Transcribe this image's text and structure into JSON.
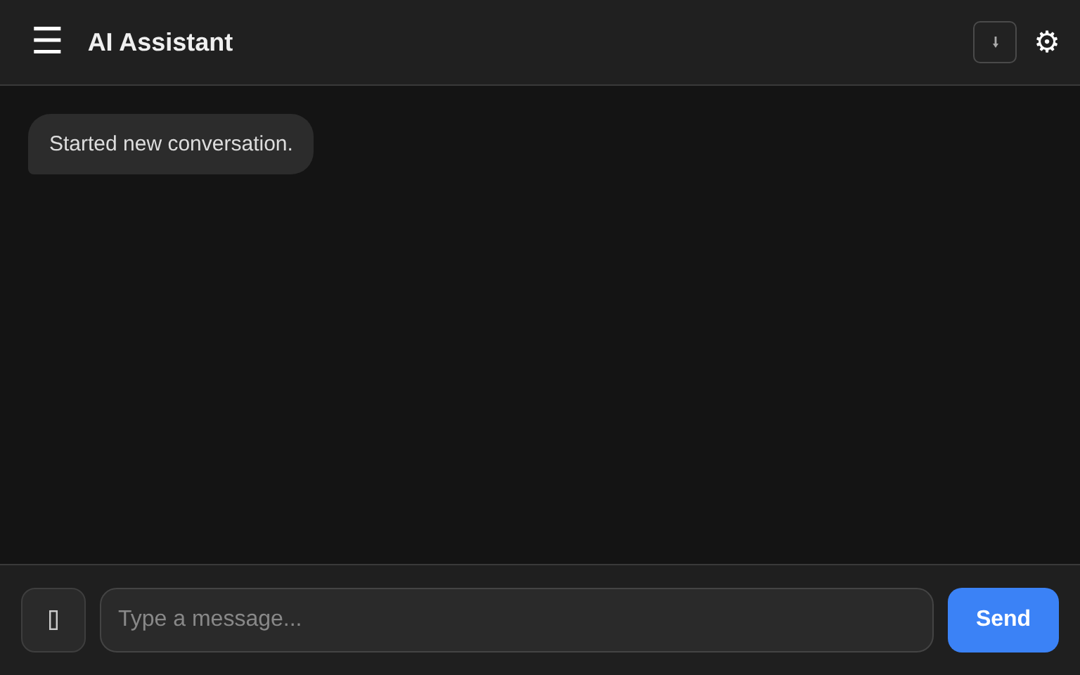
{
  "header": {
    "menu_glyph": "☰",
    "title": "AI Assistant",
    "settings_glyph": "⚙"
  },
  "messages": [
    {
      "text": "Started new conversation.",
      "kind": "system"
    }
  ],
  "composer": {
    "placeholder": "Type a message...",
    "send_label": "Send"
  }
}
